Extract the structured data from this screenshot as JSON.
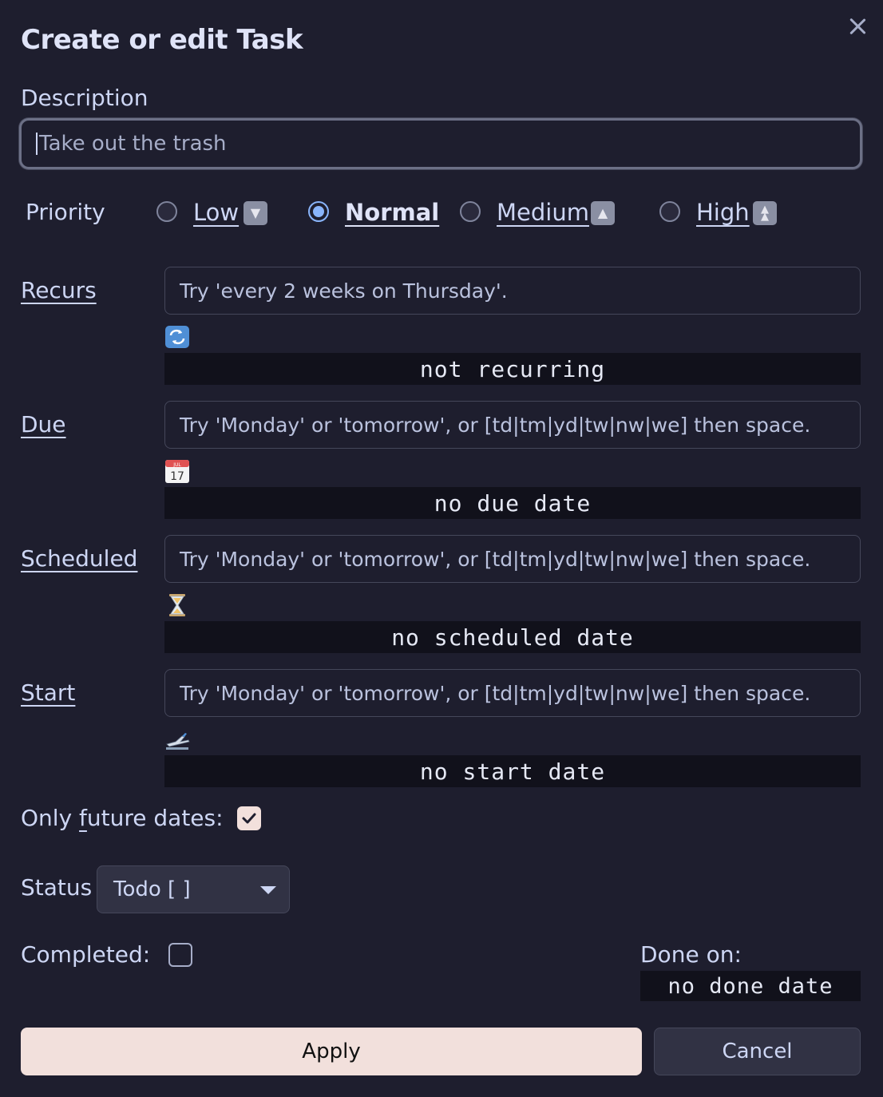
{
  "dialog": {
    "title": "Create or edit Task"
  },
  "description": {
    "label": "Description",
    "placeholder": "Take out the trash"
  },
  "priority": {
    "label": "Priority",
    "options": [
      {
        "label": "Low",
        "icon": "low-priority-icon",
        "selected": false
      },
      {
        "label": "Normal",
        "icon": "none",
        "selected": true
      },
      {
        "label": "Medium",
        "icon": "medium-priority-icon",
        "selected": false
      },
      {
        "label": "High",
        "icon": "high-priority-icon",
        "selected": false
      }
    ]
  },
  "recurs": {
    "label": "Recurs",
    "placeholder": "Try 'every 2 weeks on Thursday'.",
    "icon": "repeat-icon",
    "status": "not recurring"
  },
  "due": {
    "label": "Due",
    "placeholder": "Try 'Monday' or 'tomorrow', or [td|tm|yd|tw|nw|we] then space.",
    "icon": "calendar-icon",
    "calendar_month": "JUL",
    "calendar_day": "17",
    "status": "no due date"
  },
  "scheduled": {
    "label": "Scheduled",
    "placeholder": "Try 'Monday' or 'tomorrow', or [td|tm|yd|tw|nw|we] then space.",
    "icon": "hourglass-icon",
    "status": "no scheduled date"
  },
  "start": {
    "label": "Start",
    "placeholder": "Try 'Monday' or 'tomorrow', or [td|tm|yd|tw|nw|we] then space.",
    "icon": "airplane-departure-icon",
    "status": "no start date"
  },
  "future_dates": {
    "label": "Only future dates:",
    "checked": true
  },
  "status_field": {
    "label": "Status",
    "selected": "Todo [ ]"
  },
  "completed": {
    "label": "Completed:",
    "checked": false
  },
  "done_on": {
    "label": "Done on:",
    "value": "no done date"
  },
  "actions": {
    "apply": "Apply",
    "cancel": "Cancel"
  },
  "colors": {
    "background": "#1e1e2e",
    "accent": "#89b4fa",
    "apply_button": "#f2e0dc",
    "date_bar": "#11111b"
  }
}
